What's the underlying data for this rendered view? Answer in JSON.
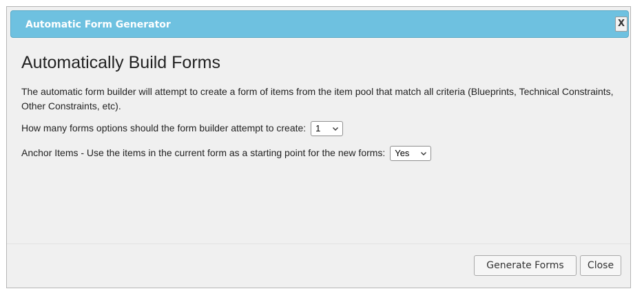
{
  "dialog": {
    "title": "Automatic Form Generator",
    "close_label": "X",
    "heading": "Automatically Build Forms",
    "description": "The automatic form builder will attempt to create a form of items from the item pool that match all criteria (Blueprints, Technical Constraints, Other Constraints, etc).",
    "forms_count": {
      "label": "How many forms options should the form builder attempt to create:",
      "selected": "1"
    },
    "anchor_items": {
      "label": "Anchor Items - Use the items in the current form as a starting point for the new forms:",
      "selected": "Yes"
    },
    "buttons": {
      "generate": "Generate Forms",
      "close": "Close"
    }
  },
  "colors": {
    "titlebar": "#6ec1e0",
    "dialog_background": "#f0f0f0"
  }
}
